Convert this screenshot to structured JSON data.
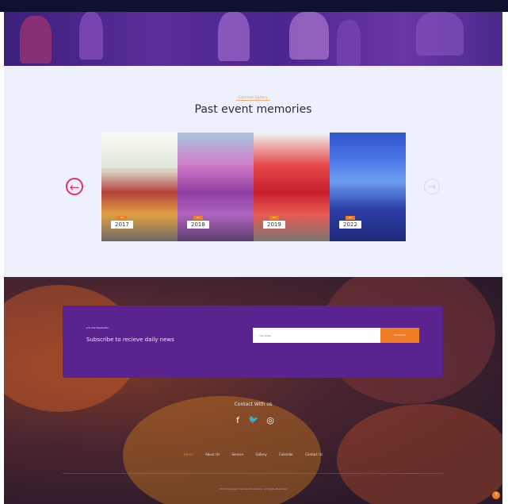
{
  "memories": {
    "tag": "Carnival Gallery",
    "title": "Past event memories",
    "prev_icon": "arrow-left-icon",
    "next_icon": "arrow-right-icon",
    "cards": [
      {
        "badge": "EV",
        "year": "2017"
      },
      {
        "badge": "EV",
        "year": "2018"
      },
      {
        "badge": "EV",
        "year": "2019"
      },
      {
        "badge": "EV",
        "year": "2022"
      }
    ]
  },
  "newsletter": {
    "label": "Join the Newsletter",
    "heading": "Subscribe to recieve daily news",
    "placeholder": "Your Email",
    "button": "Subscribe"
  },
  "contact": {
    "title": "Contact With us",
    "socials": [
      {
        "icon": "facebook-icon",
        "glyph": "f"
      },
      {
        "icon": "twitter-icon",
        "glyph": "🐦"
      },
      {
        "icon": "instagram-icon",
        "glyph": "◎"
      }
    ]
  },
  "nav": [
    "Home",
    "About Us",
    "Service",
    "Gallery",
    "Calendar",
    "Contact Us"
  ],
  "copyright": "2023 Copyright Carnival Experience. All Rights Reserved",
  "colors": {
    "accent": "#f07c24",
    "purple": "#5b2390",
    "pink": "#e3306c"
  }
}
